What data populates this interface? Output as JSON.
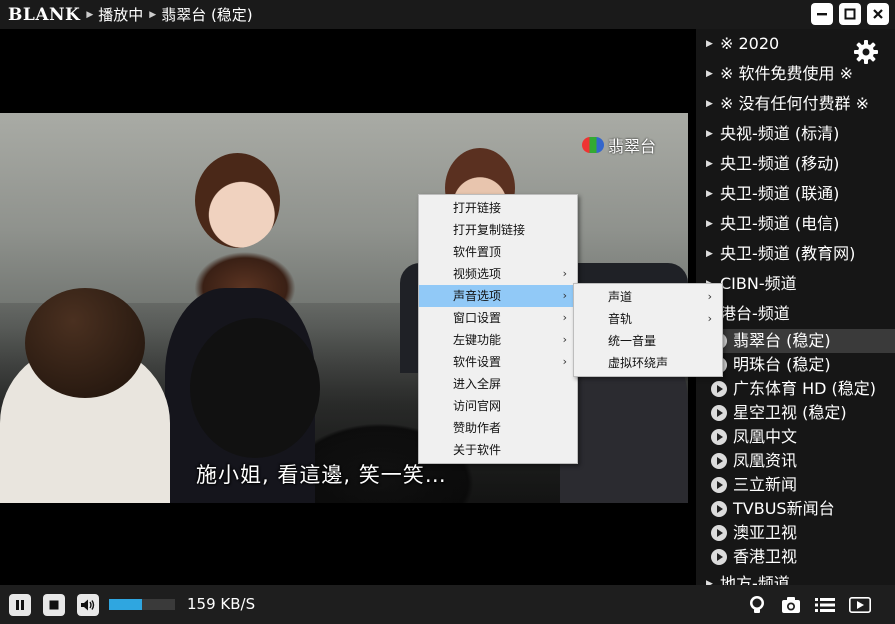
{
  "titlebar": {
    "logo": "BLANK",
    "breadcrumb": [
      "播放中",
      "翡翠台 (稳定)"
    ],
    "separator_icon": "small-right-triangle"
  },
  "video": {
    "channel_logo_text": "翡翠台",
    "subtitle": "施小姐, 看這邊, 笑一笑…"
  },
  "context_menu": {
    "items": [
      {
        "label": "打开链接",
        "submenu": false
      },
      {
        "label": "打开复制链接",
        "submenu": false
      },
      {
        "label": "软件置顶",
        "submenu": false
      },
      {
        "label": "视频选项",
        "submenu": true
      },
      {
        "label": "声音选项",
        "submenu": true,
        "highlighted": true
      },
      {
        "label": "窗口设置",
        "submenu": true
      },
      {
        "label": "左键功能",
        "submenu": true
      },
      {
        "label": "软件设置",
        "submenu": true
      },
      {
        "label": "进入全屏",
        "submenu": false
      },
      {
        "label": "访问官网",
        "submenu": false
      },
      {
        "label": "赞助作者",
        "submenu": false
      },
      {
        "label": "关于软件",
        "submenu": false
      }
    ],
    "sound_submenu": [
      {
        "label": "声道",
        "submenu": true
      },
      {
        "label": "音轨",
        "submenu": true
      },
      {
        "label": "统一音量",
        "submenu": false
      },
      {
        "label": "虚拟环绕声",
        "submenu": false
      }
    ]
  },
  "sidebar": {
    "groups": [
      {
        "label": "※ 2020"
      },
      {
        "label": "※ 软件免费使用 ※"
      },
      {
        "label": "※ 没有任何付费群 ※"
      },
      {
        "label": "央视-频道 (标清)"
      },
      {
        "label": "央卫-频道 (移动)"
      },
      {
        "label": "央卫-频道 (联通)"
      },
      {
        "label": "央卫-频道 (电信)"
      },
      {
        "label": "央卫-频道 (教育网)"
      },
      {
        "label": "CIBN-频道"
      },
      {
        "label": "港台-频道"
      }
    ],
    "channels": [
      {
        "label": "翡翠台 (稳定)",
        "active": true
      },
      {
        "label": "明珠台 (稳定)"
      },
      {
        "label": "广东体育 HD (稳定)"
      },
      {
        "label": "星空卫视 (稳定)"
      },
      {
        "label": "凤凰中文"
      },
      {
        "label": "凤凰资讯"
      },
      {
        "label": "三立新闻"
      },
      {
        "label": "TVBUS新闻台"
      },
      {
        "label": "澳亚卫视"
      },
      {
        "label": "香港卫视"
      }
    ],
    "trailing_group": {
      "label": "地方-频道"
    }
  },
  "controls": {
    "download_speed": "159 KB/S",
    "volume_level": 0.5,
    "icons": [
      "pause-icon",
      "stop-icon",
      "volume-icon",
      "lightbulb-icon",
      "camera-icon",
      "playlist-icon",
      "play-next-icon"
    ]
  },
  "colors": {
    "accent": "#2fa6e0",
    "menu_highlight": "#91c9f7",
    "sidebar_bg": "#161616",
    "active_row": "#3a3a3a"
  }
}
